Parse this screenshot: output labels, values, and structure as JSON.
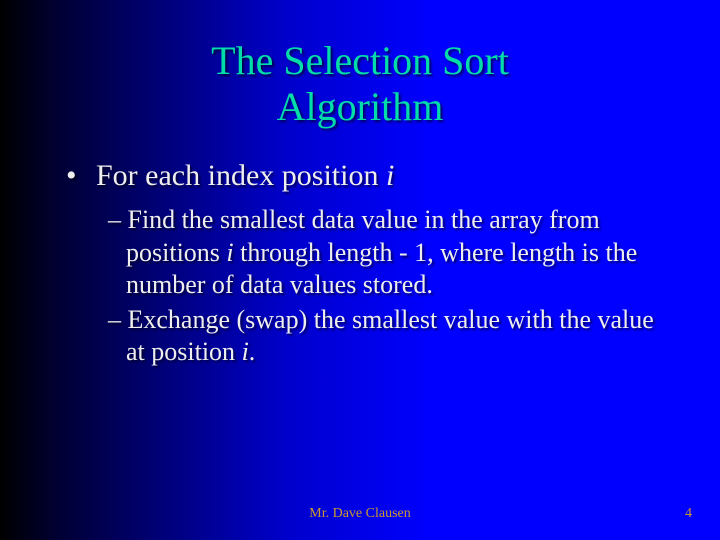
{
  "title_line1": "The Selection Sort",
  "title_line2": "Algorithm",
  "bullet": {
    "prefix": "For each index position ",
    "var": "i"
  },
  "sub1": {
    "p1": "Find the smallest data value in the array from positions ",
    "v1": "i",
    "p2": " through length - 1, where length is the number of data values stored."
  },
  "sub2": {
    "p1": "Exchange (swap) the smallest value with the value at position ",
    "v1": "i",
    "p2": "."
  },
  "footer": {
    "author": "Mr. Dave Clausen",
    "page": "4"
  }
}
